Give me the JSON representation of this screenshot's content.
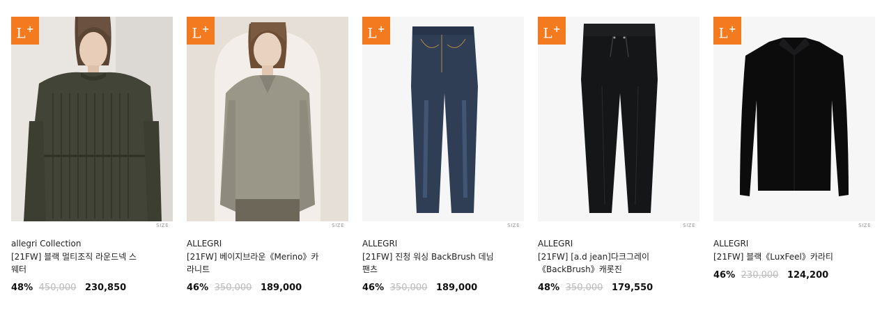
{
  "products": [
    {
      "badge": "L",
      "badge_sup": "+",
      "size_label": "SIZE",
      "brand": "allegri Collection",
      "title_line1": "[21FW] 블랙 멀티조직 라운드넥 스",
      "title_line2": "웨터",
      "discount": "48%",
      "original_price": "450,000",
      "sale_price": "230,850"
    },
    {
      "badge": "L",
      "badge_sup": "+",
      "size_label": "SIZE",
      "brand": "ALLEGRI",
      "title_line1": "[21FW] 베이지브라운《Merino》카",
      "title_line2": "라니트",
      "discount": "46%",
      "original_price": "350,000",
      "sale_price": "189,000"
    },
    {
      "badge": "L",
      "badge_sup": "+",
      "size_label": "SIZE",
      "brand": "ALLEGRI",
      "title_line1": "[21FW] 진청 워싱 BackBrush 데님",
      "title_line2": "팬츠",
      "discount": "46%",
      "original_price": "350,000",
      "sale_price": "189,000"
    },
    {
      "badge": "L",
      "badge_sup": "+",
      "size_label": "SIZE",
      "brand": "ALLEGRI",
      "title_line1": "[21FW] [a.d jean]다크그레이",
      "title_line2": "《BackBrush》캐롯진",
      "discount": "48%",
      "original_price": "350,000",
      "sale_price": "179,550"
    },
    {
      "badge": "L",
      "badge_sup": "+",
      "size_label": "SIZE",
      "brand": "ALLEGRI",
      "title_line1": "[21FW] 블랙《LuxFeel》카라티",
      "title_line2": "",
      "discount": "46%",
      "original_price": "230,000",
      "sale_price": "124,200"
    }
  ]
}
